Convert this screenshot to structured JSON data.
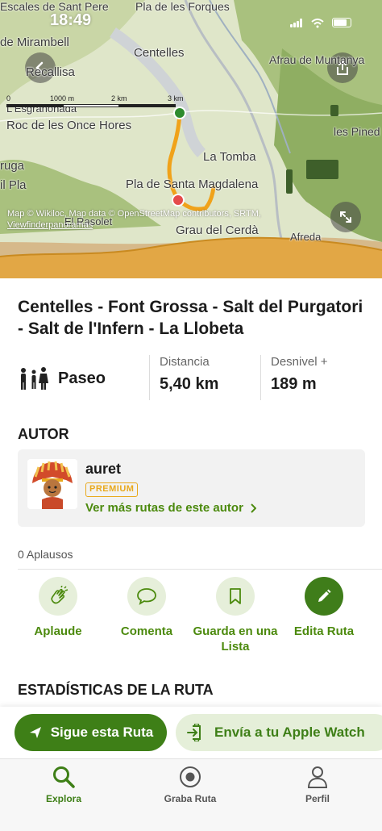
{
  "status_bar": {
    "time": "18:49"
  },
  "map": {
    "labels": {
      "escales": "Escales de Sant Pere",
      "pla_forques": "Pla de les Forques",
      "mirambell": "de Mirambell",
      "centelles": "Centelles",
      "afrau": "Afrau de Muntanya",
      "recallisa": "Recallisa",
      "esgrahonada": "L'Esgrahonada",
      "roc_once": "Roc de les Once Hores",
      "ruga": "ruga",
      "pineda": "les Pined",
      "la_tomba": "La Tomba",
      "pla_magdalena": "Pla de Santa Magdalena",
      "il_pla": "il Pla",
      "el_rasolet": "El Rasolet",
      "grau_cerda": "Grau del Cerdà",
      "afreda": "Afreda"
    },
    "scale": {
      "t0": "0",
      "t1": "1000 m",
      "t2": "2 km",
      "t3": "3 km"
    },
    "attribution": "Map © Wikiloc, Map data © OpenStreetMap contributors, SRTM,",
    "attribution_link1": "OpenStreetMap",
    "attribution_line2": "Viewfinderpanoramas",
    "colors": {
      "route": "#f0a21a",
      "start": "#2e8b2e",
      "end": "#e54b4b"
    }
  },
  "route": {
    "title": "Centelles - Font Grossa - Salt del Purgatori - Salt de l'Infern - La Llobeta",
    "activity": "Paseo",
    "distance_label": "Distancia",
    "distance_value": "5,40 km",
    "elevation_label": "Desnivel +",
    "elevation_value": "189 m"
  },
  "author": {
    "section_title": "AUTOR",
    "name": "auret",
    "badge": "PREMIUM",
    "more_link": "Ver más rutas de este autor"
  },
  "social": {
    "applause_count": "0 Aplausos"
  },
  "actions": [
    {
      "label": "Aplaude",
      "icon": "clap-icon"
    },
    {
      "label": "Comenta",
      "icon": "comment-icon"
    },
    {
      "label": "Guarda en una Lista",
      "icon": "bookmark-icon"
    },
    {
      "label": "Edita Ruta",
      "icon": "pencil-icon"
    }
  ],
  "stats_section": {
    "title": "ESTADÍSTICAS DE LA RUTA"
  },
  "cta": {
    "primary": "Sigue esta Ruta",
    "secondary": "Envía a tu Apple Watch"
  },
  "tabbar": [
    {
      "label": "Explora",
      "icon": "search-icon",
      "active": true
    },
    {
      "label": "Graba Ruta",
      "icon": "record-icon",
      "active": false
    },
    {
      "label": "Perfil",
      "icon": "profile-icon",
      "active": false
    }
  ],
  "theme": {
    "accent": "#3e7f17",
    "accent_light": "#e5efd9",
    "premium": "#e9a91c"
  }
}
